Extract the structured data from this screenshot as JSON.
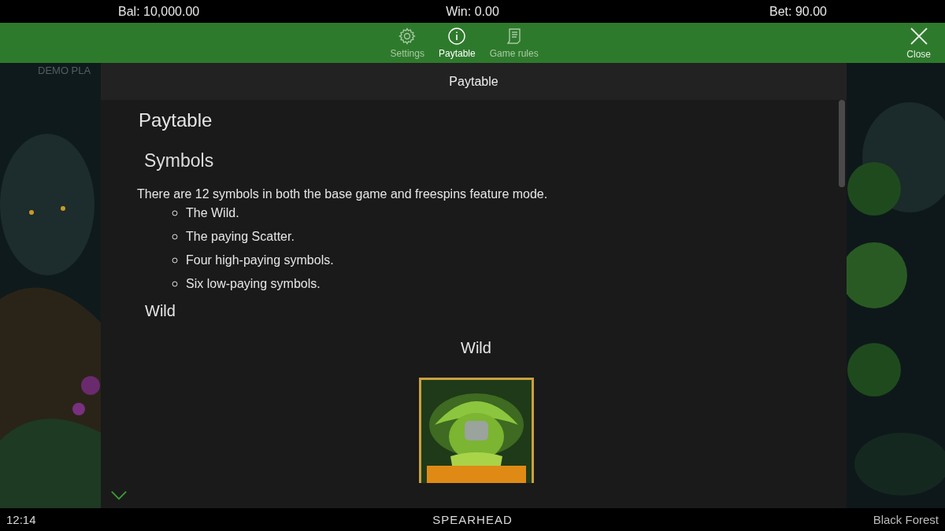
{
  "top_bar": {
    "balance": "Bal: 10,000.00",
    "win": "Win:  0.00",
    "bet": "Bet: 90.00"
  },
  "nav": [
    {
      "label": "Settings",
      "kind": "gear",
      "selected": false
    },
    {
      "label": "Paytable",
      "kind": "info",
      "selected": true
    },
    {
      "label": "Game rules",
      "kind": "scroll",
      "selected": false
    }
  ],
  "close": {
    "label": "Close"
  },
  "game_background": {
    "demo_label": "DEMO PLA"
  },
  "panel": {
    "title": "Paytable",
    "heading": "Paytable",
    "section": "Symbols",
    "intro": "There are 12 symbols in both the base game and freespins feature mode.",
    "bullets": [
      "The Wild.",
      "The paying Scatter.",
      "Four high-paying symbols.",
      "Six low-paying symbols."
    ],
    "subsection": "Wild",
    "symbol_caption": "Wild"
  },
  "bottom_bar": {
    "time": "12:14",
    "brand": "SPEARHEAD",
    "game": "Black Forest"
  }
}
